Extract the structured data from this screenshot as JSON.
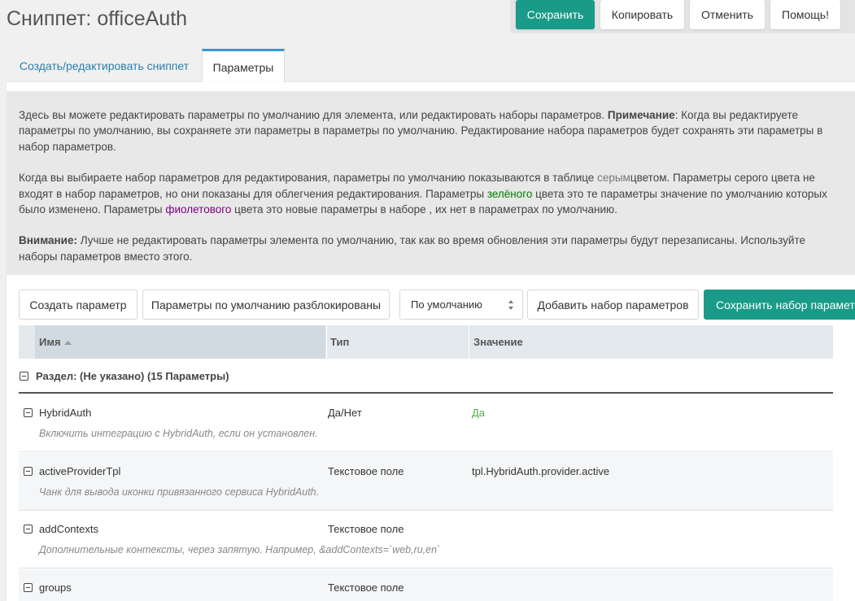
{
  "header": {
    "title": "Сниппет: officeAuth"
  },
  "actions": {
    "save": "Сохранить",
    "copy": "Копировать",
    "cancel": "Отменить",
    "help": "Помощь!"
  },
  "tabs": [
    {
      "label": "Создать/редактировать сниппет"
    },
    {
      "label": "Параметры"
    }
  ],
  "info": {
    "p1_a": "Здесь вы можете редактировать параметры по умолчанию для элемента, или редактировать наборы параметров. ",
    "p1_b": "Примечание",
    "p1_c": ": Когда вы редактируете параметры по умолчанию, вы сохраняете эти параметры в параметры по умолчанию. Редактирование набора параметров будет сохранять эти параметры в набор параметров.",
    "p2_a": "Когда вы выбираете набор параметров для редактирования, параметры по умолчанию показываются в таблице ",
    "p2_gray": "серым",
    "p2_b": "цветом. Параметры серого цвета не входят в набор параметров, но они показаны для облегчения редактирования. Параметры ",
    "p2_green": "зелёного",
    "p2_c": " цвета это те параметры значение по умолчанию которых было изменено. Параметры ",
    "p2_purple": "фиолетового",
    "p2_d": " цвета это новые параметры в наборе , их нет в параметрах по умолчанию.",
    "p3_b": "Внимание:",
    "p3_c": " Лучше не редактировать параметры элемента по умолчанию, так как во время обновления эти параметры будут перезаписаны. Используйте наборы параметров вместо этого."
  },
  "toolbar": {
    "create_param": "Создать параметр",
    "defaults_unlocked": "Параметры по умолчанию разблокированы",
    "set_select": "По умолчанию",
    "add_set": "Добавить набор параметров",
    "save_set": "Сохранить набор параметров"
  },
  "grid": {
    "columns": [
      "Имя",
      "Тип",
      "Значение"
    ],
    "group_label": "Раздел: (Не указано) (15 Параметры)",
    "rows": [
      {
        "name": "HybridAuth",
        "type": "Да/Нет",
        "value": "Да",
        "desc": "Включить интеграцию с HybridAuth, если он установлен."
      },
      {
        "name": "activeProviderTpl",
        "type": "Текстовое поле",
        "value": "tpl.HybridAuth.provider.active",
        "desc": "Чанк для вывода иконки привязанного сервиса HybridAuth."
      },
      {
        "name": "addContexts",
        "type": "Текстовое поле",
        "value": "",
        "desc": "Дополнительные контексты, через запятую. Например, &addContexts=`web,ru,en`"
      },
      {
        "name": "groups",
        "type": "Текстовое поле",
        "value": "",
        "desc": ""
      }
    ]
  },
  "colors": {
    "primary": "#1a9b89",
    "tab_accent": "#3697cd",
    "value_green": "#4cae4c"
  }
}
